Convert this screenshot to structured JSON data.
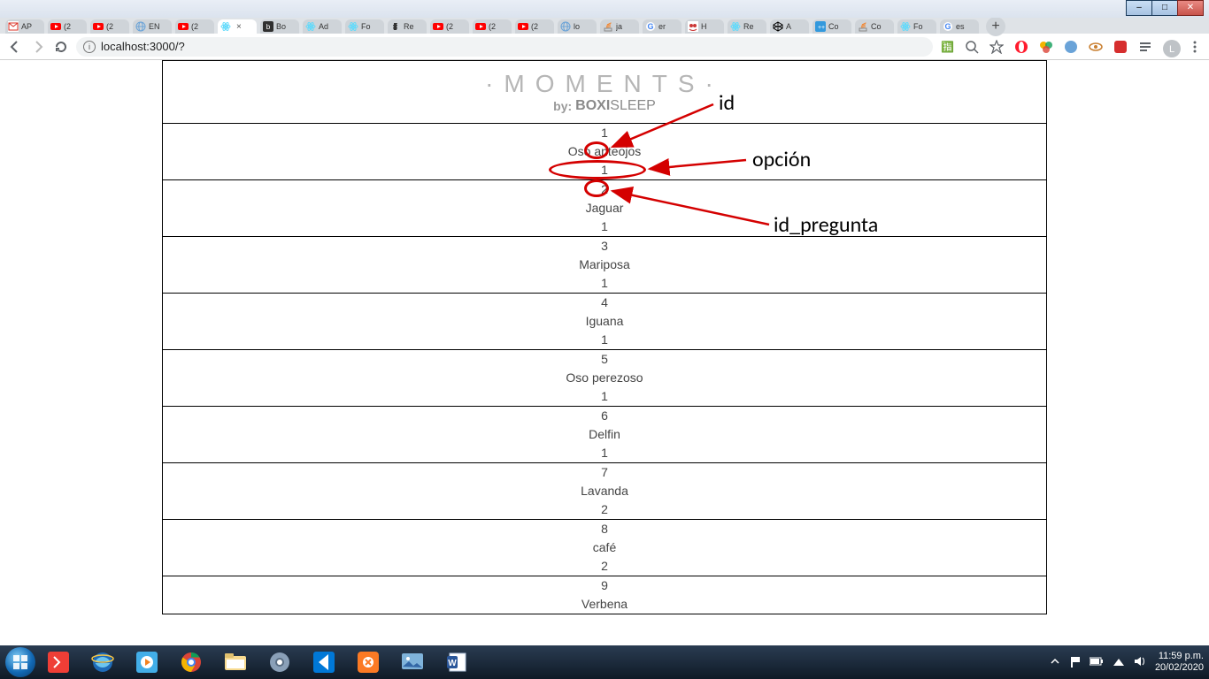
{
  "window": {
    "min_label": "–",
    "max_label": "□",
    "close_label": "✕"
  },
  "tabs": [
    {
      "label": "AP",
      "icon": "gmail-icon",
      "color": "#d93025"
    },
    {
      "label": "(2",
      "icon": "youtube-icon",
      "color": "#ff0000"
    },
    {
      "label": "(2",
      "icon": "youtube-icon",
      "color": "#ff0000"
    },
    {
      "label": "EN",
      "icon": "globe-icon",
      "color": "#6aa3d8"
    },
    {
      "label": "(2",
      "icon": "youtube-icon",
      "color": "#ff0000"
    },
    {
      "label": "",
      "icon": "react-icon",
      "color": "#61dafb",
      "active": true
    },
    {
      "label": "Bo",
      "icon": "dark-icon",
      "color": "#303030"
    },
    {
      "label": "Ad",
      "icon": "react-icon",
      "color": "#61dafb"
    },
    {
      "label": "Fo",
      "icon": "react-icon",
      "color": "#61dafb"
    },
    {
      "label": "Re",
      "icon": "chess-icon",
      "color": "#444"
    },
    {
      "label": "(2",
      "icon": "youtube-icon",
      "color": "#ff0000"
    },
    {
      "label": "(2",
      "icon": "youtube-icon",
      "color": "#ff0000"
    },
    {
      "label": "(2",
      "icon": "youtube-icon",
      "color": "#ff0000"
    },
    {
      "label": "lo",
      "icon": "globe-icon",
      "color": "#6aa3d8"
    },
    {
      "label": "ja",
      "icon": "stack-icon",
      "color": "#f48024"
    },
    {
      "label": "er",
      "icon": "google-icon",
      "color": "#4285f4"
    },
    {
      "label": "H",
      "icon": "npm-icon",
      "color": "#cb3837"
    },
    {
      "label": "Re",
      "icon": "react-icon",
      "color": "#61dafb"
    },
    {
      "label": "A",
      "icon": "codepen-icon",
      "color": "#000"
    },
    {
      "label": "Co",
      "icon": "cplus-icon",
      "color": "#3399dd"
    },
    {
      "label": "Co",
      "icon": "stack-icon",
      "color": "#f48024"
    },
    {
      "label": "Fo",
      "icon": "react-icon",
      "color": "#61dafb"
    },
    {
      "label": "es",
      "icon": "google-icon",
      "color": "#4285f4"
    }
  ],
  "newtab_label": "+",
  "address": "localhost:3000/?",
  "page": {
    "logo_main": "·MOMENTS·",
    "logo_by": "by:",
    "logo_brand_a": "BOXI",
    "logo_brand_b": "SLEEP",
    "rows": [
      {
        "id": "1",
        "opcion": "Oso anteojos",
        "id_pregunta": "1"
      },
      {
        "id": "2",
        "opcion": "Jaguar",
        "id_pregunta": "1"
      },
      {
        "id": "3",
        "opcion": "Mariposa",
        "id_pregunta": "1"
      },
      {
        "id": "4",
        "opcion": "Iguana",
        "id_pregunta": "1"
      },
      {
        "id": "5",
        "opcion": "Oso perezoso",
        "id_pregunta": "1"
      },
      {
        "id": "6",
        "opcion": "Delfin",
        "id_pregunta": "1"
      },
      {
        "id": "7",
        "opcion": "Lavanda",
        "id_pregunta": "2"
      },
      {
        "id": "8",
        "opcion": "café",
        "id_pregunta": "2"
      },
      {
        "id": "9",
        "opcion": "Verbena",
        "id_pregunta": ""
      }
    ]
  },
  "annotations": {
    "a1": "id",
    "a2": "opción",
    "a3": "id_pregunta"
  },
  "tray": {
    "time": "11:59 p.m.",
    "date": "20/02/2020"
  }
}
